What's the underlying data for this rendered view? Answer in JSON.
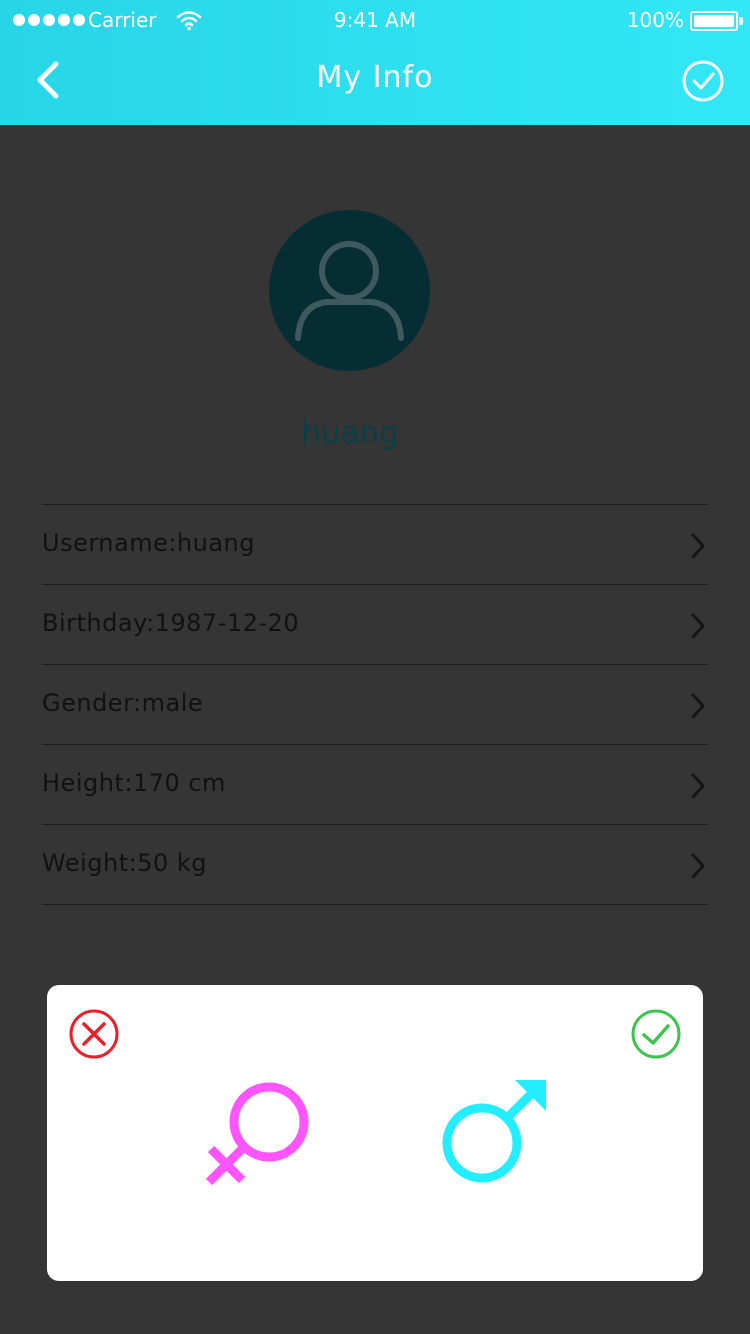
{
  "status_bar": {
    "carrier": "Carrier",
    "time": "9:41 AM",
    "battery": "100%"
  },
  "nav": {
    "title": "My Info",
    "back_icon": "chevron-left-icon",
    "confirm_icon": "check-circle-icon"
  },
  "profile": {
    "avatar_icon": "user-icon",
    "name": "huang"
  },
  "info_rows": [
    {
      "text": "Username:huang"
    },
    {
      "text": "Birthday:1987-12-20"
    },
    {
      "text": "Gender:male"
    },
    {
      "text": "Height:170 cm"
    },
    {
      "text": "Weight:50 kg"
    }
  ],
  "gender_dialog": {
    "cancel_icon": "x-circle-icon",
    "ok_icon": "check-circle-icon",
    "female_icon": "female-symbol-icon",
    "male_icon": "male-symbol-icon"
  },
  "colors": {
    "header_start": "#27d6e6",
    "header_end": "#33e7f7",
    "background": "#353535",
    "avatar_bg": "#052d33",
    "female": "#ff55ff",
    "male": "#22eeff",
    "cancel": "#e8202a",
    "ok": "#3dc44d"
  }
}
